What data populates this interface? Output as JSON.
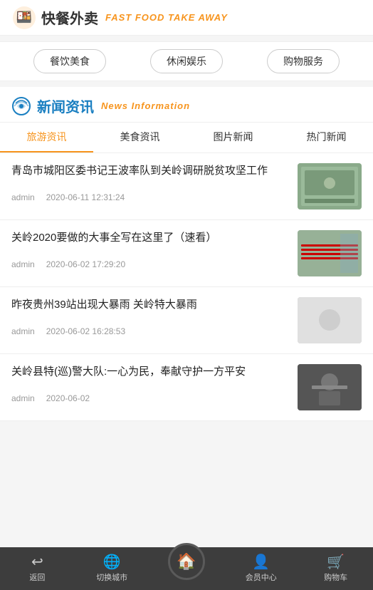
{
  "header": {
    "logo_text": "快餐外卖",
    "subtitle": "FAST FOOD TAKE AWAY"
  },
  "categories": [
    {
      "label": "餐饮美食"
    },
    {
      "label": "休闲娱乐"
    },
    {
      "label": "购物服务"
    }
  ],
  "news_section": {
    "title_cn": "新闻资讯",
    "title_en": "News Information",
    "tabs": [
      {
        "label": "旅游资讯",
        "active": true
      },
      {
        "label": "美食资讯",
        "active": false
      },
      {
        "label": "图片新闻",
        "active": false
      },
      {
        "label": "热门新闻",
        "active": false
      }
    ],
    "items": [
      {
        "title": "青岛市城阳区委书记王波率队到关岭调研脱贫攻坚工作",
        "author": "admin",
        "date": "2020-06-11 12:31:24",
        "has_thumb": true,
        "thumb_class": "thumb-1"
      },
      {
        "title": "关岭2020要做的大事全写在这里了（速看）",
        "author": "admin",
        "date": "2020-06-02 17:29:20",
        "has_thumb": true,
        "thumb_class": "thumb-2"
      },
      {
        "title": "昨夜贵州39站出现大暴雨 关岭特大暴雨",
        "author": "admin",
        "date": "2020-06-02 16:28:53",
        "has_thumb": true,
        "thumb_class": "thumb-3"
      },
      {
        "title": "关岭县特(巡)警大队:一心为民，奉献守护一方平安",
        "author": "admin",
        "date": "2020-06-02",
        "has_thumb": true,
        "thumb_class": "thumb-4"
      }
    ]
  },
  "bottom_nav": [
    {
      "label": "返回",
      "icon": "↩",
      "name": "back"
    },
    {
      "label": "切换城市",
      "icon": "🌐",
      "name": "switch-city"
    },
    {
      "label": "",
      "icon": "🏠",
      "name": "home",
      "is_home": true
    },
    {
      "label": "会员中心",
      "icon": "👤",
      "name": "member"
    },
    {
      "label": "购物车",
      "icon": "🛒",
      "name": "cart"
    }
  ]
}
